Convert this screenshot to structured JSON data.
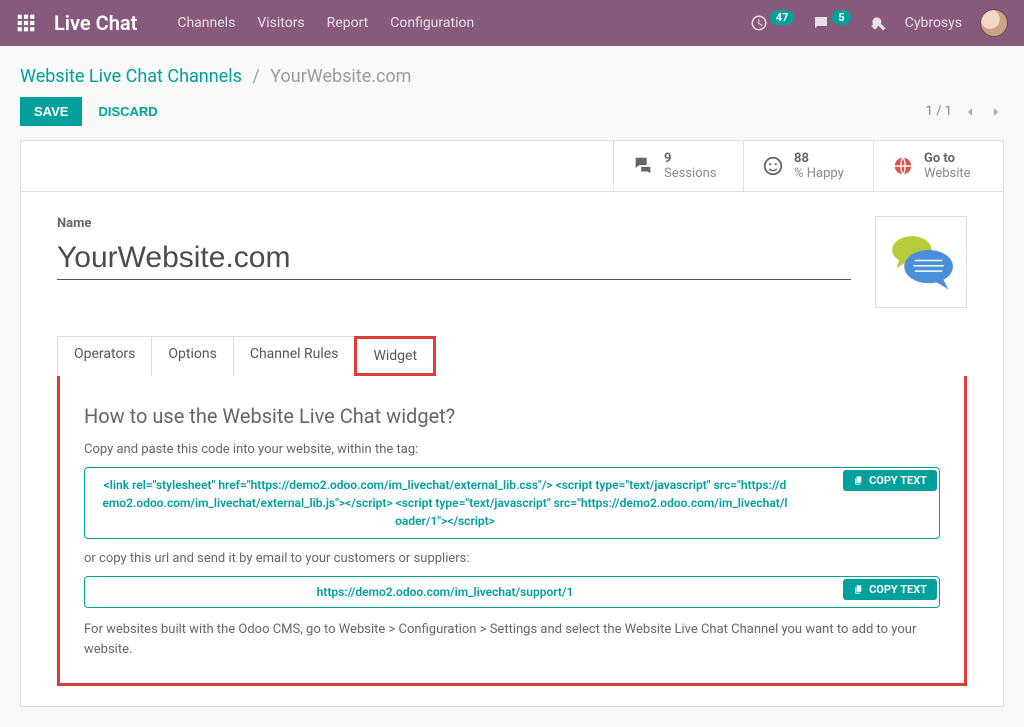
{
  "header": {
    "brand": "Live Chat",
    "nav": [
      "Channels",
      "Visitors",
      "Report",
      "Configuration"
    ],
    "timer_badge": "47",
    "chat_badge": "5",
    "user": "Cybrosys"
  },
  "breadcrumb": {
    "root": "Website Live Chat Channels",
    "sep": "/",
    "current": "YourWebsite.com"
  },
  "actions": {
    "save": "SAVE",
    "discard": "DISCARD"
  },
  "pager": {
    "count": "1 / 1"
  },
  "stats": {
    "sessions_num": "9",
    "sessions_label": "Sessions",
    "happy_num": "88",
    "happy_label": "% Happy",
    "goto_line1": "Go to",
    "goto_line2": "Website"
  },
  "form": {
    "name_label": "Name",
    "name_value": "YourWebsite.com"
  },
  "tabs": [
    "Operators",
    "Options",
    "Channel Rules",
    "Widget"
  ],
  "widget": {
    "title": "How to use the Website Live Chat widget?",
    "p1": "Copy and paste this code into your website, within the tag:",
    "code1": "<link rel=\"stylesheet\" href=\"https://demo2.odoo.com/im_livechat/external_lib.css\"/> <script type=\"text/javascript\" src=\"https://demo2.odoo.com/im_livechat/external_lib.js\"></script> <script type=\"text/javascript\" src=\"https://demo2.odoo.com/im_livechat/loader/1\"></script>",
    "p2": "or copy this url and send it by email to your customers or suppliers:",
    "code2": "https://demo2.odoo.com/im_livechat/support/1",
    "p3": "For websites built with the Odoo CMS, go to Website > Configuration > Settings and select the Website Live Chat Channel you want to add to your website.",
    "copy_label": "COPY TEXT"
  }
}
